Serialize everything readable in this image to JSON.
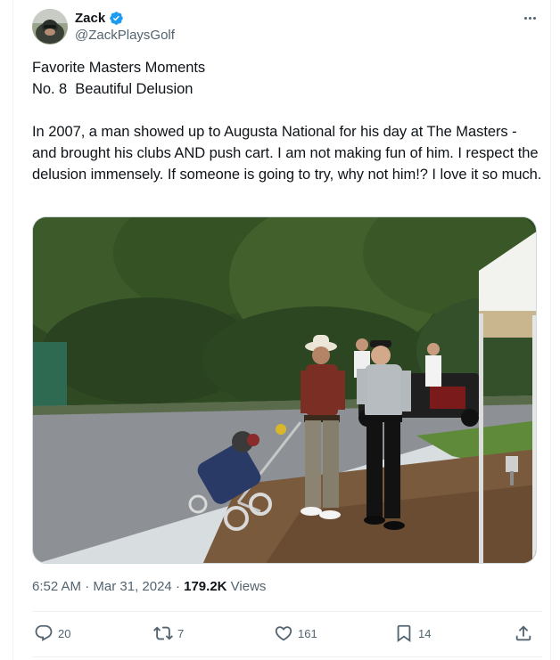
{
  "author": {
    "display_name": "Zack",
    "handle": "@ZackPlaysGolf",
    "verified": true,
    "verified_color": "#1d9bf0"
  },
  "tweet": {
    "text": "Favorite Masters Moments\nNo. 8  Beautiful Delusion\n\nIn 2007, a man showed up to Augusta National for his day at The Masters - and brought his clubs AND push cart. I am not making fun of him. I respect the delusion immensely. If someone is going to try, why not him!? I love it so much."
  },
  "meta": {
    "time": "6:52 AM",
    "separator": "·",
    "date": "Mar 31, 2024",
    "views_count": "179.2K",
    "views_label": "Views"
  },
  "actions": {
    "replies": "20",
    "reposts": "7",
    "likes": "161",
    "bookmarks": "14"
  },
  "icons": {
    "more": "more-horizontal-icon",
    "reply": "reply-icon",
    "repost": "repost-icon",
    "like": "heart-icon",
    "bookmark": "bookmark-icon",
    "share": "share-icon",
    "verified": "verified-badge-icon"
  },
  "colors": {
    "text_primary": "#0f1419",
    "text_secondary": "#536471",
    "border": "#eff3f4"
  }
}
